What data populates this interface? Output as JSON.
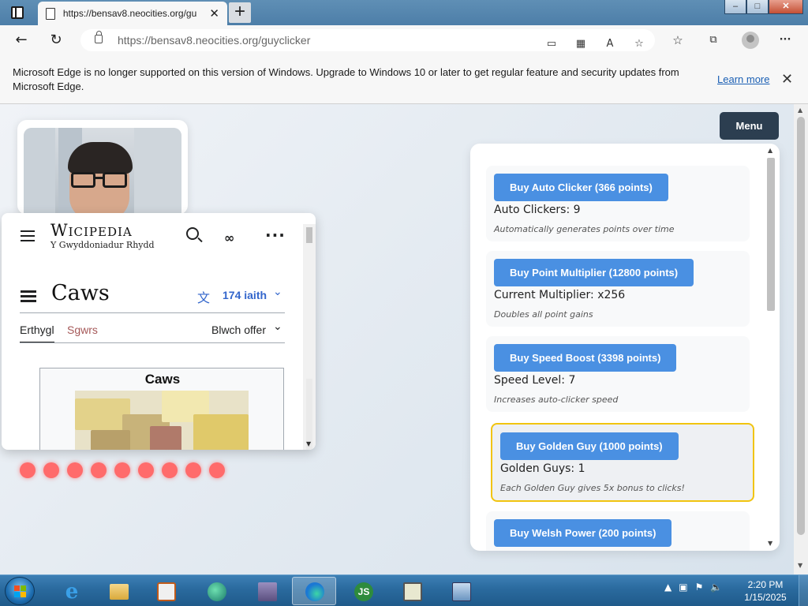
{
  "browser": {
    "tab_title": "https://bensav8.neocities.org/gu",
    "tab_close": "✕",
    "new_tab": "+",
    "window_buttons": {
      "minimize": "–",
      "maximize": "□",
      "close": "✕"
    },
    "url": "https://bensav8.neocities.org/guyclicker",
    "icons": [
      "sidebar-toggle-icon",
      "back-arrow-icon",
      "refresh-icon",
      "lock-icon",
      "app-available-icon",
      "qr-icon",
      "read-aloud-icon",
      "add-favorite-icon",
      "favorites-icon",
      "collections-icon",
      "profile-icon",
      "more-icon"
    ],
    "back": "←",
    "refresh": "↻",
    "more": "···"
  },
  "notice": {
    "text": "Microsoft Edge is no longer supported on this version of Windows. Upgrade to Windows 10 or later to get regular feature and security updates from Microsoft Edge.",
    "learn_more": "Learn more",
    "close": "✕"
  },
  "wiki": {
    "logo": "Wicipedia",
    "subtitle": "Y Gwyddoniadur Rhydd",
    "page_title": "Caws",
    "languages": "174 iaith",
    "tabs": {
      "article": "Erthygl",
      "talk": "Sgwrs",
      "tools": "Blwch offer"
    },
    "infobox_title": "Caws"
  },
  "game": {
    "menu_label": "Menu",
    "dot_count": 9,
    "dot_color": "#ff6b6b",
    "upgrades": [
      {
        "button": "Buy Auto Clicker (366 points)",
        "stat": "Auto Clickers: 9",
        "desc": "Automatically generates points over time"
      },
      {
        "button": "Buy Point Multiplier (12800 points)",
        "stat": "Current Multiplier: x256",
        "desc": "Doubles all point gains"
      },
      {
        "button": "Buy Speed Boost (3398 points)",
        "stat": "Speed Level: 7",
        "desc": "Increases auto-clicker speed"
      },
      {
        "button": "Buy Golden Guy (1000 points)",
        "stat": "Golden Guys: 1",
        "desc": "Each Golden Guy gives 5x bonus to clicks!"
      },
      {
        "button": "Buy Welsh Power (200 points)",
        "stat": "",
        "desc": ""
      }
    ],
    "colors": {
      "button": "#4a90e2",
      "menu": "#2c3e50",
      "golden_border": "#f1c40f"
    }
  },
  "taskbar": {
    "time": "2:20 PM",
    "date": "1/15/2025",
    "pinned": [
      "internet-explorer",
      "file-explorer",
      "media-player",
      "app-green",
      "winrar",
      "edge",
      "js-app",
      "system-monitor",
      "remote-desktop"
    ]
  }
}
